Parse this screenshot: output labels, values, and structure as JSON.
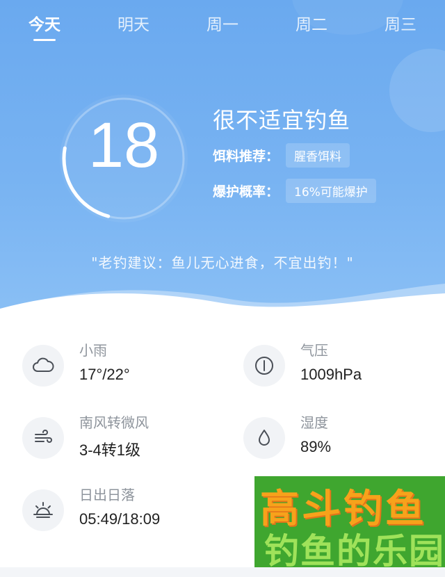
{
  "tabs": [
    {
      "label": "今天",
      "active": true
    },
    {
      "label": "明天",
      "active": false
    },
    {
      "label": "周一",
      "active": false
    },
    {
      "label": "周二",
      "active": false
    },
    {
      "label": "周三",
      "active": false
    }
  ],
  "gauge": {
    "value": "18"
  },
  "verdict": "很不适宜钓鱼",
  "bait": {
    "label": "饵料推荐：",
    "value": "腥香饵料"
  },
  "burst": {
    "label": "爆护概率：",
    "value": "16%可能爆护"
  },
  "advice": "\"老钓建议：鱼儿无心进食，不宜出钓！\"",
  "details": {
    "weather": {
      "title": "小雨",
      "value": "17°/22°",
      "icon": "cloud-icon"
    },
    "pressure": {
      "title": "气压",
      "value": "1009hPa",
      "icon": "gauge-icon"
    },
    "wind": {
      "title": "南风转微风",
      "value": "3-4转1级",
      "icon": "wind-icon"
    },
    "humidity": {
      "title": "湿度",
      "value": "89%",
      "icon": "water-drop-icon"
    },
    "sun": {
      "title": "日出日落",
      "value": "05:49/18:09",
      "icon": "sunrise-icon"
    }
  },
  "watermark": {
    "line1": "高斗钓鱼",
    "line2": "钓鱼的乐园"
  },
  "colors": {
    "hero_top": "#6aa9ef",
    "hero_bottom": "#8bc0f5",
    "watermark_bg": "#3fa62f",
    "watermark_text": "#f7a21b"
  }
}
